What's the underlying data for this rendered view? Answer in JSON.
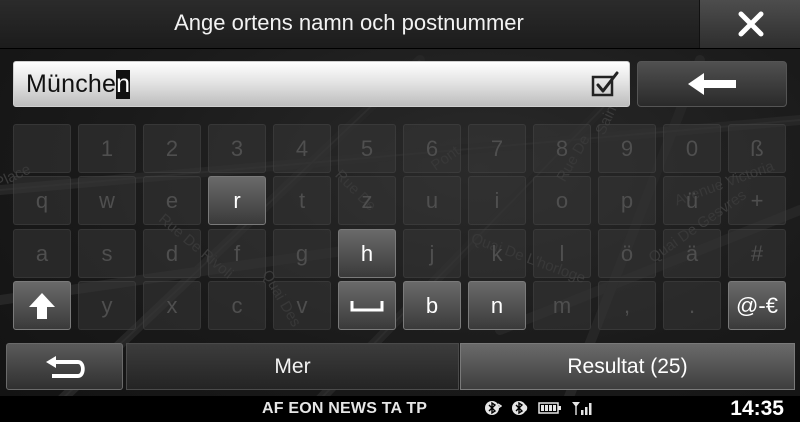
{
  "header": {
    "title": "Ange ortens namn och postnummer"
  },
  "input": {
    "text_before_cursor": "Münche",
    "cursor_char": "n"
  },
  "keyboard": {
    "rows": [
      [
        {
          "label": "",
          "state": "disabled"
        },
        {
          "label": "1",
          "state": "disabled"
        },
        {
          "label": "2",
          "state": "disabled"
        },
        {
          "label": "3",
          "state": "disabled"
        },
        {
          "label": "4",
          "state": "disabled"
        },
        {
          "label": "5",
          "state": "disabled"
        },
        {
          "label": "6",
          "state": "disabled"
        },
        {
          "label": "7",
          "state": "disabled"
        },
        {
          "label": "8",
          "state": "disabled"
        },
        {
          "label": "9",
          "state": "disabled"
        },
        {
          "label": "0",
          "state": "disabled"
        },
        {
          "label": "ß",
          "state": "disabled"
        }
      ],
      [
        {
          "label": "q",
          "state": "disabled"
        },
        {
          "label": "w",
          "state": "disabled"
        },
        {
          "label": "e",
          "state": "disabled"
        },
        {
          "label": "r",
          "state": "active"
        },
        {
          "label": "t",
          "state": "disabled"
        },
        {
          "label": "z",
          "state": "disabled"
        },
        {
          "label": "u",
          "state": "disabled"
        },
        {
          "label": "i",
          "state": "disabled"
        },
        {
          "label": "o",
          "state": "disabled"
        },
        {
          "label": "p",
          "state": "disabled"
        },
        {
          "label": "ü",
          "state": "disabled"
        },
        {
          "label": "+",
          "state": "disabled"
        }
      ],
      [
        {
          "label": "a",
          "state": "disabled"
        },
        {
          "label": "s",
          "state": "disabled"
        },
        {
          "label": "d",
          "state": "disabled"
        },
        {
          "label": "f",
          "state": "disabled"
        },
        {
          "label": "g",
          "state": "disabled"
        },
        {
          "label": "h",
          "state": "active"
        },
        {
          "label": "j",
          "state": "disabled"
        },
        {
          "label": "k",
          "state": "disabled"
        },
        {
          "label": "l",
          "state": "disabled"
        },
        {
          "label": "ö",
          "state": "disabled"
        },
        {
          "label": "ä",
          "state": "disabled"
        },
        {
          "label": "#",
          "state": "disabled"
        }
      ],
      [
        {
          "label": "",
          "state": "special",
          "icon": "shift-arrow-icon"
        },
        {
          "label": "y",
          "state": "disabled"
        },
        {
          "label": "x",
          "state": "disabled"
        },
        {
          "label": "c",
          "state": "disabled"
        },
        {
          "label": "v",
          "state": "disabled"
        },
        {
          "label": "",
          "state": "active",
          "icon": "space-icon"
        },
        {
          "label": "b",
          "state": "active"
        },
        {
          "label": "n",
          "state": "active"
        },
        {
          "label": "m",
          "state": "disabled"
        },
        {
          "label": ",",
          "state": "disabled"
        },
        {
          "label": ".",
          "state": "disabled"
        },
        {
          "label": "@-€",
          "state": "special"
        }
      ]
    ]
  },
  "bottom": {
    "more_label": "Mer",
    "results_label": "Resultat (25)"
  },
  "status": {
    "flags": "AF EON NEWS TA TP",
    "time": "14:35"
  },
  "map_labels": [
    "Rue De",
    "Quai De Gesvres",
    "Avenue Victoria",
    "Rue",
    "Rue De Rivoli",
    "Quai De L'horloge",
    "Quai Des",
    "Pont",
    "Place",
    "Saint"
  ],
  "icons": [
    "close-icon",
    "check-icon",
    "backspace-arrow-icon",
    "shift-arrow-icon",
    "space-icon",
    "return-arrow-icon",
    "bluetooth-phone-icon",
    "bluetooth-audio-icon",
    "battery-icon",
    "signal-icon"
  ]
}
